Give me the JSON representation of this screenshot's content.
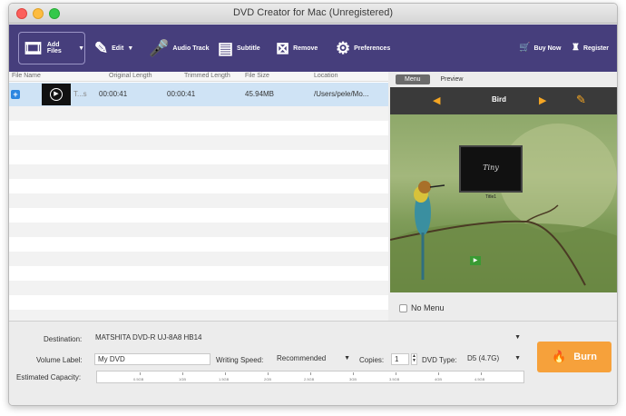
{
  "window": {
    "title": "DVD Creator for Mac (Unregistered)"
  },
  "toolbar": {
    "add_files": "Add Files",
    "edit": "Edit",
    "audio_track": "Audio Track",
    "subtitle": "Subtitle",
    "remove": "Remove",
    "preferences": "Preferences",
    "buy_now": "Buy Now",
    "register": "Register"
  },
  "file_list": {
    "headers": {
      "name": "File Name",
      "original_length": "Original Length",
      "trimmed_length": "Trimmed Length",
      "file_size": "File Size",
      "location": "Location"
    },
    "rows": [
      {
        "name": "T...s",
        "original_length": "00:00:41",
        "trimmed_length": "00:00:41",
        "file_size": "45.94MB",
        "location": "/Users/pele/Mo..."
      }
    ]
  },
  "preview": {
    "tabs": [
      "Menu",
      "Preview"
    ],
    "active_tab": "Menu",
    "menu_title": "Bird",
    "thumb_signature": "Tiny",
    "thumb_label": "Title1",
    "no_menu_label": "No Menu"
  },
  "bottom": {
    "destination_label": "Destination:",
    "destination_value": "MATSHITA DVD-R   UJ-8A8 HB14",
    "volume_label_label": "Volume Label:",
    "volume_label_value": "My DVD",
    "writing_speed_label": "Writing Speed:",
    "writing_speed_value": "Recommended",
    "copies_label": "Copies:",
    "copies_value": "1",
    "dvd_type_label": "DVD Type:",
    "dvd_type_value": "D5 (4.7G)",
    "estimated_capacity_label": "Estimated Capacity:",
    "capacity_ticks": [
      "0.5GB",
      "1GB",
      "1.5GB",
      "2GB",
      "2.5GB",
      "3GB",
      "3.5GB",
      "4GB",
      "4.5GB"
    ],
    "burn_label": "Burn"
  },
  "colors": {
    "toolbar": "#463e7c",
    "accent": "#f6a13b",
    "selection": "#cfe3f5"
  }
}
